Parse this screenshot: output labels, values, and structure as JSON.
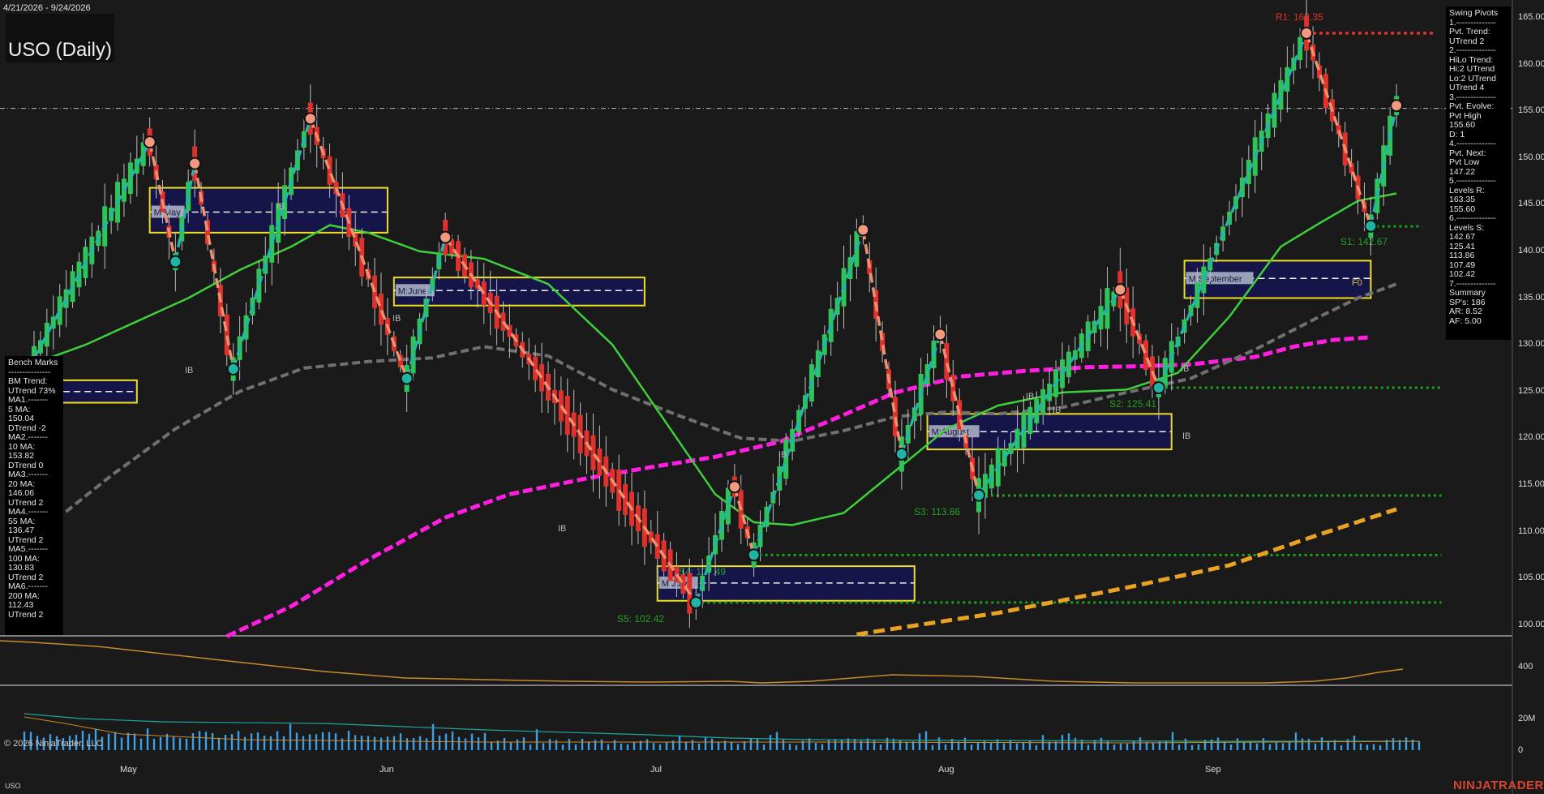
{
  "header": {
    "date_range": "4/21/2026 - 9/24/2026",
    "title": "USO (Daily)"
  },
  "swing_panel": {
    "lines": [
      "Swing Pivots",
      "1.--------------",
      "Pvt. Trend:",
      "UTrend 2",
      "2.--------------",
      "HiLo Trend:",
      "Hi:2 UTrend",
      "Lo:2 UTrend",
      "UTrend 4",
      "3.--------------",
      "Pvt. Evolve:",
      "Pvt High",
      "155.60",
      "D: 1",
      "4.--------------",
      "Pvt. Next:",
      "Pvt Low",
      "147.22",
      "5.--------------",
      "Levels R:",
      "163.35",
      "155.60",
      "6.--------------",
      "Levels S:",
      "142.67",
      "125.41",
      "113.86",
      "107.49",
      "102.42",
      "7.--------------",
      "Summary",
      "SP's: 186",
      "AR: 8.52",
      "AF: 5.00"
    ]
  },
  "bench_panel": {
    "lines": [
      "Bench Marks",
      "---------------",
      "BM Trend:",
      "UTrend 73%",
      "MA1.-------",
      "5 MA:",
      "150.04",
      "DTrend -2",
      "MA2.-------",
      "10 MA:",
      "153.82",
      "DTrend 0",
      "MA3.-------",
      "20 MA:",
      "146.06",
      "UTrend 2",
      "MA4.-------",
      "55 MA:",
      "136.47",
      "UTrend 2",
      "MA5.-------",
      "100 MA:",
      "130.83",
      "UTrend 2",
      "MA6.-------",
      "200 MA:",
      "112.43",
      "UTrend 2"
    ]
  },
  "axis": {
    "price_labels": [
      "165.00",
      "160.00",
      "155.00",
      "150.00",
      "145.00",
      "140.00",
      "135.00",
      "130.00",
      "125.00",
      "120.00",
      "115.00",
      "110.00",
      "105.00",
      "100.00"
    ],
    "osc_label": "400",
    "vol_labels": [
      "20M",
      "0"
    ],
    "months": [
      "May",
      "Jun",
      "Jul",
      "Aug",
      "Sep"
    ]
  },
  "footer": {
    "copyright": "© 2026 NinjaTrader, LLC",
    "symbol": "USO",
    "brand": "NINJATRADER"
  },
  "colors": {
    "bg": "#1a1a1a",
    "up": "#2ec45a",
    "down": "#e0322c",
    "ma_green": "#3fcf3a",
    "ma_gray": "#707070",
    "ma_magenta": "#ff1fe0",
    "ma_orange": "#e9a224",
    "swing_up": "#26b3a8",
    "swing_down": "#f0906e"
  },
  "chart_data": {
    "type": "line",
    "ylim": [
      99,
      168
    ],
    "months": [
      "May",
      "Jun",
      "Jul",
      "Aug",
      "Sep"
    ],
    "levels": {
      "R1": {
        "label": "R1: 163.35",
        "value": 163.35
      },
      "S1": {
        "label": "S1: 142.67",
        "value": 142.67
      },
      "S2": {
        "label": "S2: 125.41",
        "value": 125.41
      },
      "S3": {
        "label": "S3: 113.86",
        "value": 113.86
      },
      "S4": {
        "label": "S4: 107.49",
        "value": 107.49
      },
      "S5": {
        "label": "S5: 102.42",
        "value": 102.42
      }
    },
    "swing_pivots": [
      {
        "t": 0,
        "v": 128.5
      },
      {
        "t": 18,
        "v": 151.7
      },
      {
        "t": 22,
        "v": 138.9
      },
      {
        "t": 25,
        "v": 149.4
      },
      {
        "t": 31,
        "v": 127.4
      },
      {
        "t": 43,
        "v": 154.2
      },
      {
        "t": 58,
        "v": 126.4
      },
      {
        "t": 64,
        "v": 141.5
      },
      {
        "t": 103,
        "v": 102.4
      },
      {
        "t": 109,
        "v": 114.8
      },
      {
        "t": 112,
        "v": 107.5
      },
      {
        "t": 129,
        "v": 142.3
      },
      {
        "t": 135,
        "v": 118.3
      },
      {
        "t": 141,
        "v": 131.1
      },
      {
        "t": 147,
        "v": 113.9
      },
      {
        "t": 169,
        "v": 135.9
      },
      {
        "t": 175,
        "v": 125.4
      },
      {
        "t": 198,
        "v": 163.35
      },
      {
        "t": 208,
        "v": 142.7
      },
      {
        "t": 212,
        "v": 155.6
      }
    ],
    "ma_20": [
      [
        0,
        128
      ],
      [
        8,
        130
      ],
      [
        16,
        132.5
      ],
      [
        24,
        135
      ],
      [
        32,
        138
      ],
      [
        40,
        140.5
      ],
      [
        46,
        142.8
      ],
      [
        52,
        142
      ],
      [
        60,
        140
      ],
      [
        70,
        139.2
      ],
      [
        80,
        136.5
      ],
      [
        90,
        130
      ],
      [
        100,
        120
      ],
      [
        106,
        114
      ],
      [
        112,
        111
      ],
      [
        118,
        110.7
      ],
      [
        126,
        112
      ],
      [
        134,
        116.5
      ],
      [
        142,
        121
      ],
      [
        150,
        123.5
      ],
      [
        160,
        124.9
      ],
      [
        170,
        125.2
      ],
      [
        178,
        127
      ],
      [
        186,
        133
      ],
      [
        194,
        140.5
      ],
      [
        200,
        143
      ],
      [
        206,
        145.4
      ],
      [
        212,
        146.2
      ]
    ],
    "ma_55": [
      [
        2,
        110.5
      ],
      [
        12,
        116
      ],
      [
        22,
        121
      ],
      [
        32,
        125
      ],
      [
        42,
        127.5
      ],
      [
        52,
        128.2
      ],
      [
        62,
        128.6
      ],
      [
        70,
        129.8
      ],
      [
        80,
        128.8
      ],
      [
        90,
        125.2
      ],
      [
        100,
        122.5
      ],
      [
        110,
        120
      ],
      [
        118,
        119.7
      ],
      [
        126,
        120.8
      ],
      [
        134,
        122.3
      ],
      [
        142,
        122.8
      ],
      [
        150,
        122.6
      ],
      [
        160,
        123.3
      ],
      [
        170,
        124.9
      ],
      [
        180,
        126.4
      ],
      [
        190,
        129.5
      ],
      [
        200,
        133
      ],
      [
        206,
        135
      ],
      [
        212,
        136.5
      ]
    ],
    "ma_100": [
      [
        30,
        98.8
      ],
      [
        40,
        102
      ],
      [
        52,
        107
      ],
      [
        64,
        111.5
      ],
      [
        74,
        114
      ],
      [
        86,
        115.7
      ],
      [
        96,
        116.9
      ],
      [
        106,
        118
      ],
      [
        116,
        119.6
      ],
      [
        126,
        122.5
      ],
      [
        134,
        124.9
      ],
      [
        144,
        126.6
      ],
      [
        154,
        127.2
      ],
      [
        164,
        127.6
      ],
      [
        172,
        127.7
      ],
      [
        180,
        127.9
      ],
      [
        190,
        128.7
      ],
      [
        196,
        129.8
      ],
      [
        202,
        130.5
      ],
      [
        208,
        130.8
      ]
    ],
    "ma_200": [
      [
        128,
        99
      ],
      [
        150,
        101.3
      ],
      [
        170,
        104
      ],
      [
        186,
        106.4
      ],
      [
        200,
        109.7
      ],
      [
        212,
        112.4
      ]
    ],
    "monthly_boxes": [
      {
        "label": "M:May",
        "t0": 18,
        "t1": 55,
        "top": 146.8,
        "bottom": 142.0,
        "mid": 144.2
      },
      {
        "label": "M:June",
        "t0": 56,
        "t1": 95,
        "top": 137.2,
        "bottom": 134.2,
        "mid": 135.8
      },
      {
        "label": "M:July",
        "t0": 97,
        "t1": 137,
        "top": 106.3,
        "bottom": 102.6,
        "mid": 104.5
      },
      {
        "label": "M:August",
        "t0": 139,
        "t1": 177,
        "top": 122.6,
        "bottom": 118.8,
        "mid": 120.7
      },
      {
        "label": "M:September",
        "t0": 179,
        "t1": 208,
        "top": 139.0,
        "bottom": 135.0,
        "mid": 137.1
      },
      {
        "label": "",
        "t0": -2,
        "t1": 16,
        "top": 126.2,
        "bottom": 123.8,
        "mid": 125.0
      }
    ],
    "annotations": [
      "IB",
      "IB",
      "IB",
      "IB",
      "IB",
      "IB",
      "IB",
      "IB",
      "IB",
      "F0"
    ],
    "volume_unit": "M"
  }
}
